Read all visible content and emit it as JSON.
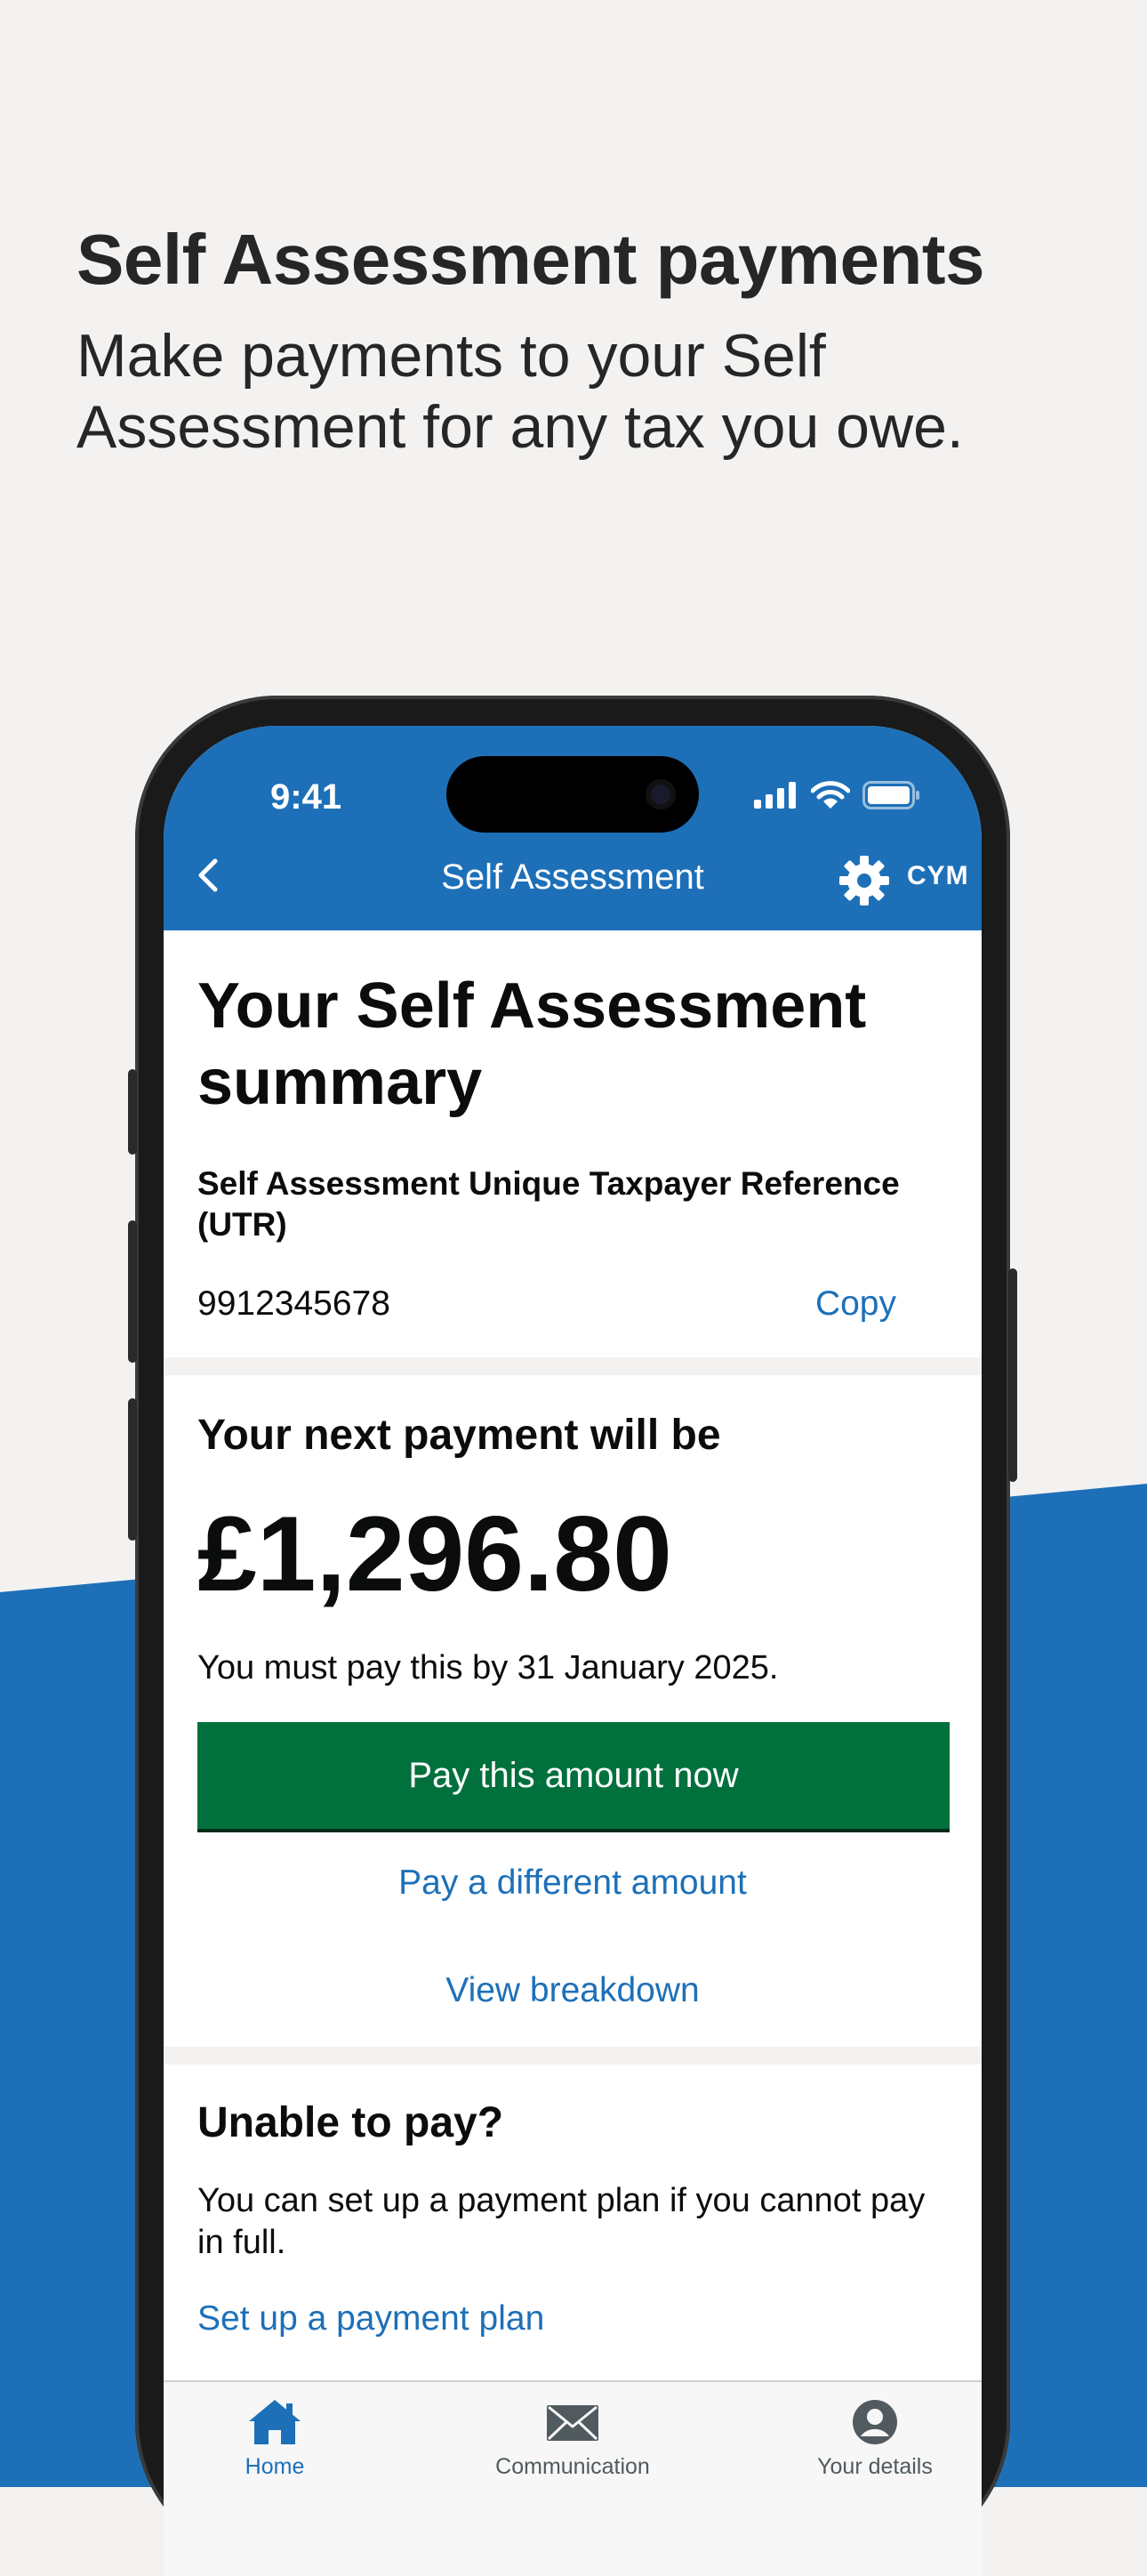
{
  "marketing": {
    "title": "Self Assessment payments",
    "subtitle": "Make payments to your Self Assessment for any tax you owe."
  },
  "status_bar": {
    "time": "9:41"
  },
  "nav": {
    "title": "Self Assessment",
    "language_toggle": "CYM"
  },
  "summary": {
    "heading": "Your Self Assessment summary",
    "utr_label": "Self Assessment Unique Taxpayer Reference (UTR)",
    "utr_value": "9912345678",
    "copy_label": "Copy"
  },
  "payment": {
    "heading": "Your next payment will be",
    "amount": "£1,296.80",
    "due_text": "You must pay this by 31 January 2025.",
    "pay_button": "Pay this amount now",
    "different_amount_link": "Pay a different amount",
    "breakdown_link": "View breakdown"
  },
  "unable": {
    "heading": "Unable to pay?",
    "text": "You can set up a payment plan if you cannot pay in full.",
    "plan_link": "Set up a payment plan"
  },
  "tabs": [
    {
      "label": "Home",
      "icon": "home-icon",
      "active": true
    },
    {
      "label": "Communication",
      "icon": "envelope-icon",
      "active": false
    },
    {
      "label": "Your details",
      "icon": "person-icon",
      "active": false
    }
  ],
  "colors": {
    "brand_blue": "#1d70b8",
    "button_green": "#00703c",
    "background": "#f3f2f1",
    "text": "#0b0c0c"
  }
}
